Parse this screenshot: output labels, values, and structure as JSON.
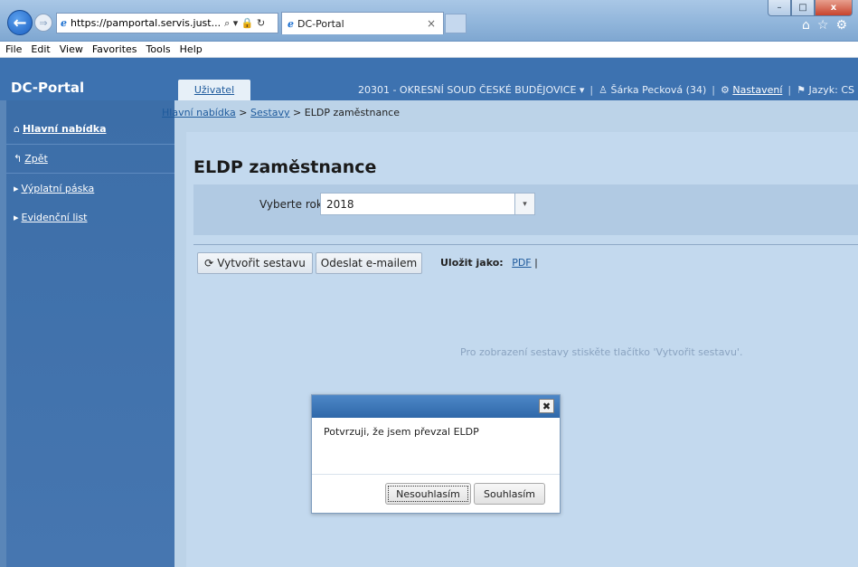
{
  "browser": {
    "url": "https://pamportal.servis.just...",
    "address_controls": "⌕ ▾ 🔒 ↻",
    "tab_title": "DC-Portal",
    "tab_close": "×",
    "menu": [
      "File",
      "Edit",
      "View",
      "Favorites",
      "Tools",
      "Help"
    ],
    "window_controls": {
      "minimize": "–",
      "maximize": "□",
      "close": "x"
    }
  },
  "app": {
    "brand": "DC-Portal",
    "user_tab": "Uživatel",
    "court": "20301 - OKRESNÍ SOUD ČESKÉ BUDĚJOVICE ▾",
    "separator": "|",
    "user": "♙ Šárka Pecková (34)",
    "settings": "Nastavení",
    "settings_icon": "⚙",
    "language": "⚑ Jazyk: CS"
  },
  "sidebar": {
    "main": "Hlavní nabídka",
    "main_icon": "⌂",
    "back": "Zpět",
    "back_icon": "↰",
    "items": [
      {
        "label": "Výplatní páska",
        "icon": "▸"
      },
      {
        "label": "Evidenční list",
        "icon": "▸"
      }
    ]
  },
  "breadcrumb": {
    "home": "Hlavní nabídka",
    "sep": ">",
    "reports": "Sestavy",
    "current": "ELDP zaměstnance"
  },
  "page": {
    "title": "ELDP zaměstnance",
    "year_label": "Vyberte rok",
    "year_value": "2018",
    "create_button": "Vytvořit sestavu",
    "create_icon": "⟳",
    "email_button": "Odeslat e-mailem",
    "save_as_label": "Uložit jako:",
    "save_as_pdf": "PDF",
    "save_as_sep": "|",
    "hint": "Pro zobrazení sestavy stiskěte tlačítko 'Vytvořit sestavu'."
  },
  "dialog": {
    "close": "✖",
    "message": "Potvrzuji, že jsem převzal ELDP",
    "disagree": "Nesouhlasím",
    "agree": "Souhlasím"
  },
  "colors": {
    "app_header": "#3d72b0",
    "content_bg": "#bcd3e8",
    "dialog_header": "#2f68a9"
  }
}
